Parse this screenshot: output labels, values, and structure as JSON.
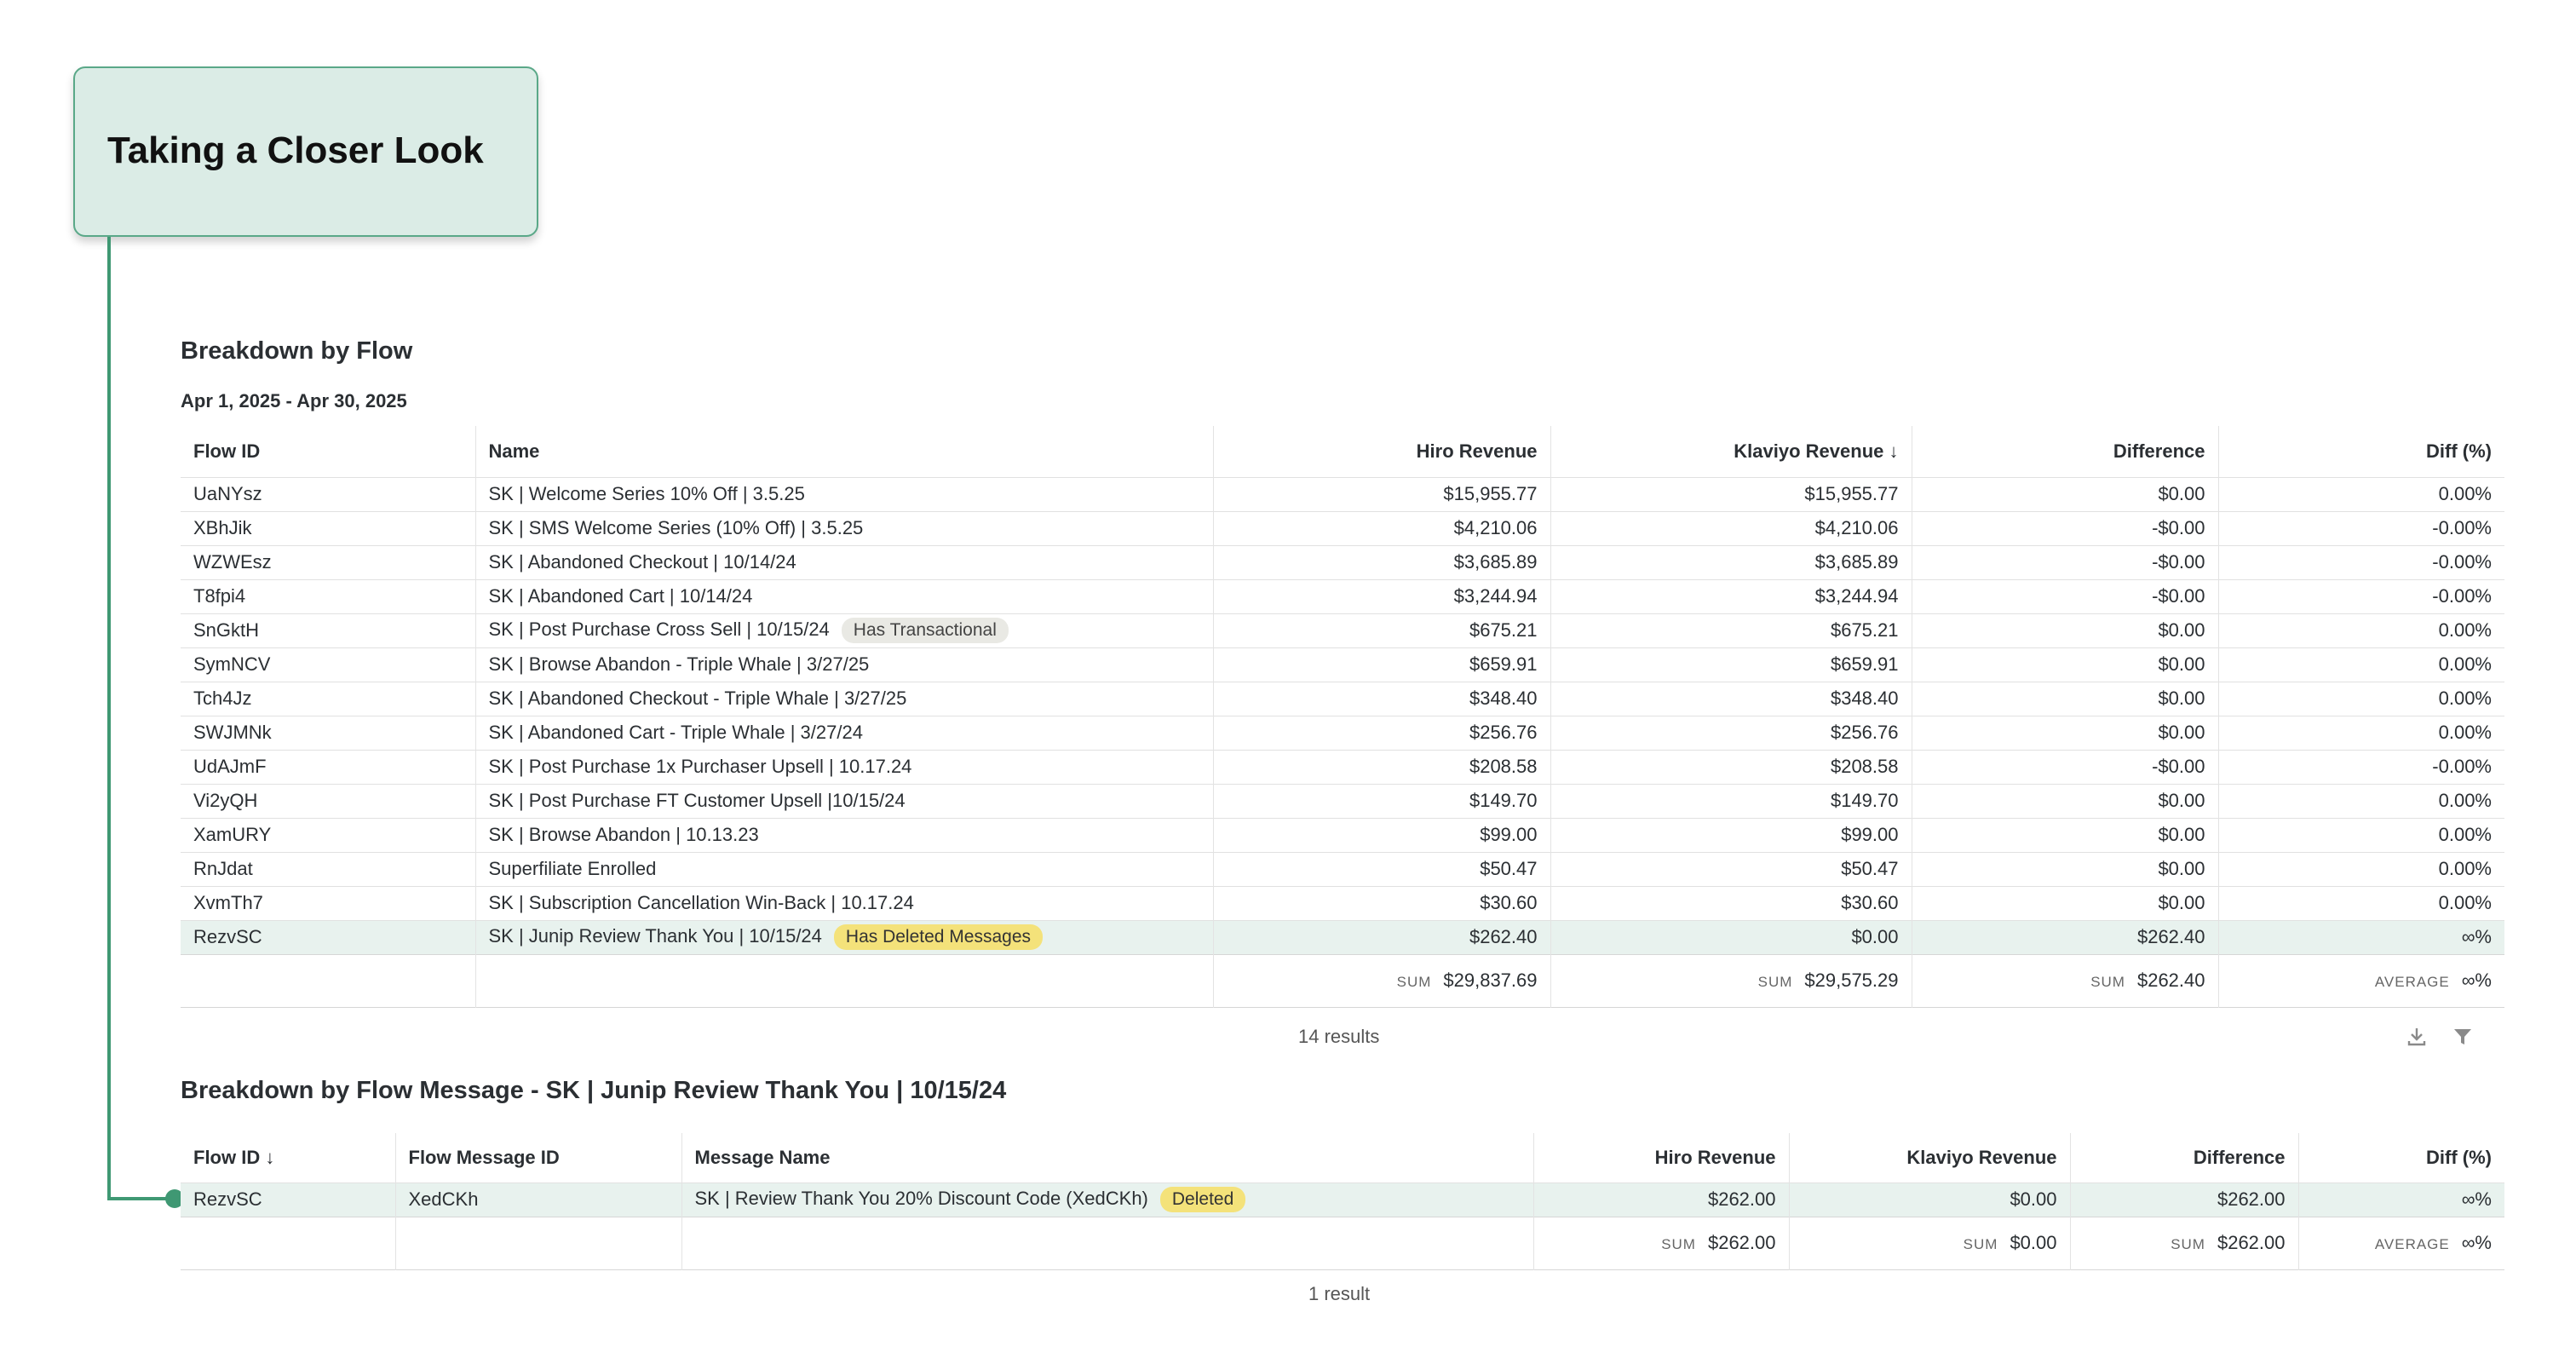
{
  "callout": {
    "title": "Taking a Closer Look"
  },
  "flow_breakdown": {
    "title": "Breakdown by Flow",
    "date_range": "Apr 1, 2025 - Apr 30, 2025",
    "columns": [
      "Flow ID",
      "Name",
      "Hiro Revenue",
      "Klaviyo Revenue",
      "Difference",
      "Diff (%)"
    ],
    "sort_indicator": "↓",
    "rows": [
      {
        "flow_id": "UaNYsz",
        "name": "SK | Welcome Series 10% Off | 3.5.25",
        "badge": "",
        "hiro": "$15,955.77",
        "klaviyo": "$15,955.77",
        "diff": "$0.00",
        "diff_pct": "0.00%"
      },
      {
        "flow_id": "XBhJik",
        "name": "SK | SMS Welcome Series (10% Off) | 3.5.25",
        "badge": "",
        "hiro": "$4,210.06",
        "klaviyo": "$4,210.06",
        "diff": "-$0.00",
        "diff_pct": "-0.00%"
      },
      {
        "flow_id": "WZWEsz",
        "name": "SK | Abandoned Checkout | 10/14/24",
        "badge": "",
        "hiro": "$3,685.89",
        "klaviyo": "$3,685.89",
        "diff": "-$0.00",
        "diff_pct": "-0.00%"
      },
      {
        "flow_id": "T8fpi4",
        "name": "SK | Abandoned Cart | 10/14/24",
        "badge": "",
        "hiro": "$3,244.94",
        "klaviyo": "$3,244.94",
        "diff": "-$0.00",
        "diff_pct": "-0.00%"
      },
      {
        "flow_id": "SnGktH",
        "name": "SK | Post Purchase Cross Sell | 10/15/24",
        "badge": "Has Transactional",
        "hiro": "$675.21",
        "klaviyo": "$675.21",
        "diff": "$0.00",
        "diff_pct": "0.00%"
      },
      {
        "flow_id": "SymNCV",
        "name": "SK | Browse Abandon - Triple Whale | 3/27/25",
        "badge": "",
        "hiro": "$659.91",
        "klaviyo": "$659.91",
        "diff": "$0.00",
        "diff_pct": "0.00%"
      },
      {
        "flow_id": "Tch4Jz",
        "name": "SK | Abandoned Checkout - Triple Whale | 3/27/25",
        "badge": "",
        "hiro": "$348.40",
        "klaviyo": "$348.40",
        "diff": "$0.00",
        "diff_pct": "0.00%"
      },
      {
        "flow_id": "SWJMNk",
        "name": "SK | Abandoned Cart - Triple Whale | 3/27/24",
        "badge": "",
        "hiro": "$256.76",
        "klaviyo": "$256.76",
        "diff": "$0.00",
        "diff_pct": "0.00%"
      },
      {
        "flow_id": "UdAJmF",
        "name": "SK | Post Purchase 1x Purchaser Upsell | 10.17.24",
        "badge": "",
        "hiro": "$208.58",
        "klaviyo": "$208.58",
        "diff": "-$0.00",
        "diff_pct": "-0.00%"
      },
      {
        "flow_id": "Vi2yQH",
        "name": "SK | Post Purchase FT Customer Upsell |10/15/24",
        "badge": "",
        "hiro": "$149.70",
        "klaviyo": "$149.70",
        "diff": "$0.00",
        "diff_pct": "0.00%"
      },
      {
        "flow_id": "XamURY",
        "name": "SK | Browse Abandon | 10.13.23",
        "badge": "",
        "hiro": "$99.00",
        "klaviyo": "$99.00",
        "diff": "$0.00",
        "diff_pct": "0.00%"
      },
      {
        "flow_id": "RnJdat",
        "name": "Superfiliate Enrolled",
        "badge": "",
        "hiro": "$50.47",
        "klaviyo": "$50.47",
        "diff": "$0.00",
        "diff_pct": "0.00%"
      },
      {
        "flow_id": "XvmTh7",
        "name": "SK | Subscription Cancellation Win-Back | 10.17.24",
        "badge": "",
        "hiro": "$30.60",
        "klaviyo": "$30.60",
        "diff": "$0.00",
        "diff_pct": "0.00%"
      },
      {
        "flow_id": "RezvSC",
        "name": "SK | Junip Review Thank You | 10/15/24",
        "badge": "Has Deleted Messages",
        "hiro": "$262.40",
        "klaviyo": "$0.00",
        "diff": "$262.40",
        "diff_pct": "∞%"
      }
    ],
    "summary": {
      "hiro_label": "SUM",
      "hiro": "$29,837.69",
      "klaviyo_label": "SUM",
      "klaviyo": "$29,575.29",
      "diff_label": "SUM",
      "diff": "$262.40",
      "pct_label": "AVERAGE",
      "pct": "∞%"
    },
    "results": "14 results"
  },
  "message_breakdown": {
    "title": "Breakdown by Flow Message - SK | Junip Review Thank You | 10/15/24",
    "columns": [
      "Flow ID",
      "Flow Message ID",
      "Message Name",
      "Hiro Revenue",
      "Klaviyo Revenue",
      "Difference",
      "Diff (%)"
    ],
    "sort_indicator": "↓",
    "rows": [
      {
        "flow_id": "RezvSC",
        "message_id": "XedCKh",
        "name": "SK | Review Thank You 20% Discount Code (XedCKh)",
        "badge": "Deleted",
        "hiro": "$262.00",
        "klaviyo": "$0.00",
        "diff": "$262.00",
        "diff_pct": "∞%"
      }
    ],
    "summary": {
      "hiro_label": "SUM",
      "hiro": "$262.00",
      "klaviyo_label": "SUM",
      "klaviyo": "$0.00",
      "diff_label": "SUM",
      "diff": "$262.00",
      "pct_label": "AVERAGE",
      "pct": "∞%"
    },
    "results": "1 result"
  },
  "icons": {
    "download": "download-icon",
    "filter": "filter-icon"
  },
  "colors": {
    "accent": "#3f9873",
    "callout_bg": "#dbece6",
    "badge_yellow": "#f4e27a",
    "badge_grey": "#e9e9e4",
    "highlight_row": "#e8f2ee"
  }
}
